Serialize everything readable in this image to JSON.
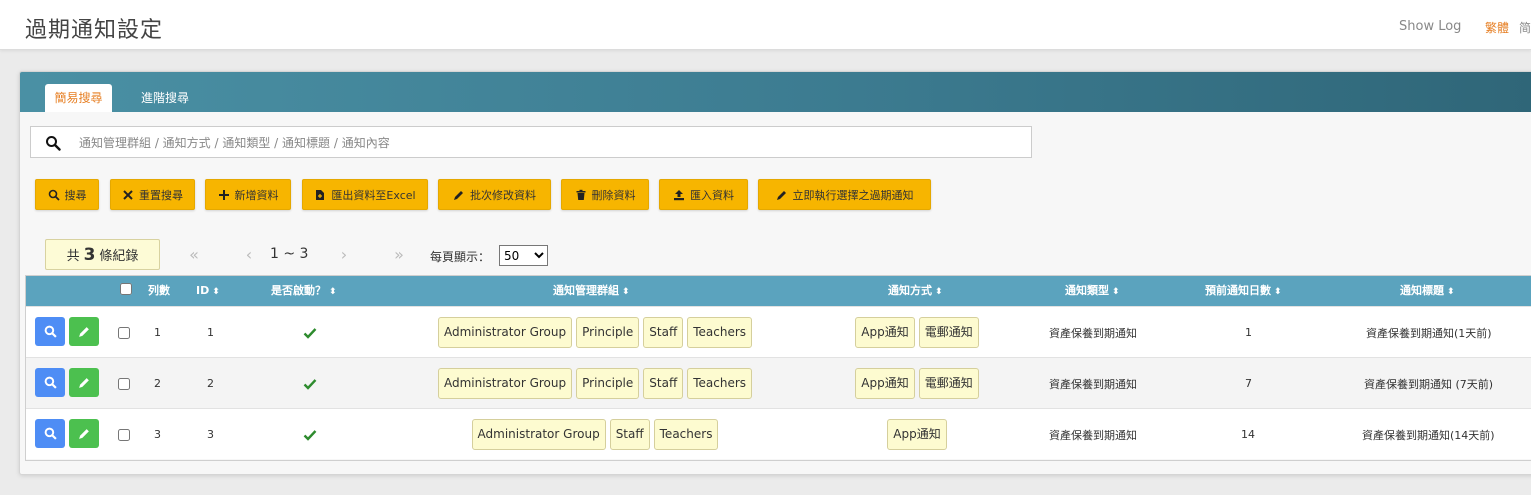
{
  "header": {
    "title": "過期通知設定",
    "show_log": "Show Log",
    "lang_traditional": "繁體",
    "lang_simplified": "简"
  },
  "tabs": {
    "simple": "簡易搜尋",
    "advanced": "進階搜尋"
  },
  "search": {
    "placeholder": "通知管理群組 / 通知方式 / 通知類型 / 通知標題 / 通知內容",
    "value": ""
  },
  "toolbar": {
    "search": "搜尋",
    "reset": "重置搜尋",
    "add": "新增資料",
    "export": "匯出資料至Excel",
    "batch_edit": "批次修改資料",
    "delete": "刪除資料",
    "import": "匯入資料",
    "execute": "立即執行選擇之過期通知"
  },
  "pagination": {
    "count_prefix": "共",
    "count": "3",
    "count_suffix": "條紀錄",
    "first": "«",
    "prev": "‹",
    "range": "1 ~ 3",
    "next": "›",
    "last": "»",
    "per_page_label": "每頁顯示：",
    "per_page_value": "50"
  },
  "table": {
    "headers": {
      "row_no": "列數",
      "id": "ID",
      "enabled": "是否啟動？",
      "groups": "通知管理群組",
      "methods": "通知方式",
      "type": "通知類型",
      "days": "預前通知日數",
      "title": "通知標題"
    },
    "rows": [
      {
        "row_no": "1",
        "id": "1",
        "groups": [
          "Administrator Group",
          "Principle",
          "Staff",
          "Teachers"
        ],
        "methods": [
          "App通知",
          "電郵通知"
        ],
        "type": "資產保養到期通知",
        "days": "1",
        "title": "資產保養到期通知(1天前)"
      },
      {
        "row_no": "2",
        "id": "2",
        "groups": [
          "Administrator Group",
          "Principle",
          "Staff",
          "Teachers"
        ],
        "methods": [
          "App通知",
          "電郵通知"
        ],
        "type": "資產保養到期通知",
        "days": "7",
        "title": "資產保養到期通知 (7天前)"
      },
      {
        "row_no": "3",
        "id": "3",
        "groups": [
          "Administrator Group",
          "Staff",
          "Teachers"
        ],
        "methods": [
          "App通知"
        ],
        "type": "資產保養到期通知",
        "days": "14",
        "title": "資產保養到期通知(14天前)"
      }
    ]
  },
  "colors": {
    "accent_orange": "#e67e22",
    "button_yellow": "#f7b500",
    "header_teal": "#5ba3be",
    "tag_bg": "#fdfbd0",
    "check_green": "#2e8b2e",
    "view_blue": "#4e8df5",
    "edit_green": "#4cc04f"
  },
  "icons": {
    "search": "search-icon",
    "reset": "times-icon",
    "add": "plus-icon",
    "export": "file-export-icon",
    "batch_edit": "pencil-icon",
    "delete": "trash-icon",
    "import": "upload-icon",
    "execute": "pencil-icon",
    "view": "search-icon",
    "edit": "pencil-icon",
    "enabled": "check-icon"
  }
}
